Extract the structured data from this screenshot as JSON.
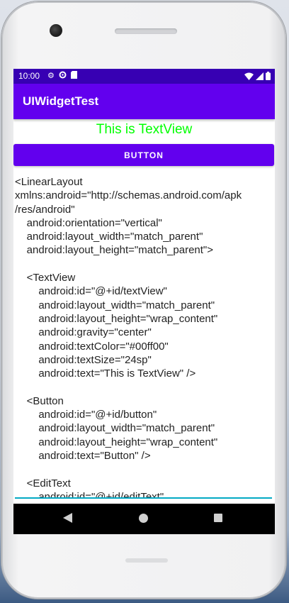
{
  "status_bar": {
    "time": "10:00",
    "left_icons": [
      "gear-icon",
      "data-saver-icon",
      "sd-card-icon"
    ],
    "right_icons": [
      "wifi-icon",
      "signal-icon",
      "battery-icon"
    ]
  },
  "app_bar": {
    "title": "UIWidgetTest"
  },
  "text_view": {
    "text": "This is TextView",
    "color": "#00ff00"
  },
  "button": {
    "label": "BUTTON"
  },
  "edit_text": {
    "lines": [
      "<LinearLayout",
      "xmlns:android=\"http://schemas.android.com/apk",
      "/res/android\"",
      "    android:orientation=\"vertical\"",
      "    android:layout_width=\"match_parent\"",
      "    android:layout_height=\"match_parent\">",
      "",
      "    <TextView",
      "        android:id=\"@+id/textView\"",
      "        android:layout_width=\"match_parent\"",
      "        android:layout_height=\"wrap_content\"",
      "        android:gravity=\"center\"",
      "        android:textColor=\"#00ff00\"",
      "        android:textSize=\"24sp\"",
      "        android:text=\"This is TextView\" />",
      "",
      "    <Button",
      "        android:id=\"@+id/button\"",
      "        android:layout_width=\"match_parent\"",
      "        android:layout_height=\"wrap_content\"",
      "        android:text=\"Button\" />",
      "",
      "    <EditText",
      "        android:id=\"@+id/editText\""
    ]
  },
  "nav_bar": {
    "icons": [
      "back-icon",
      "home-icon",
      "recents-icon"
    ]
  },
  "colors": {
    "primary": "#6200ee",
    "primary_dark": "#3700b3",
    "accent_underline": "#03a9c4"
  }
}
